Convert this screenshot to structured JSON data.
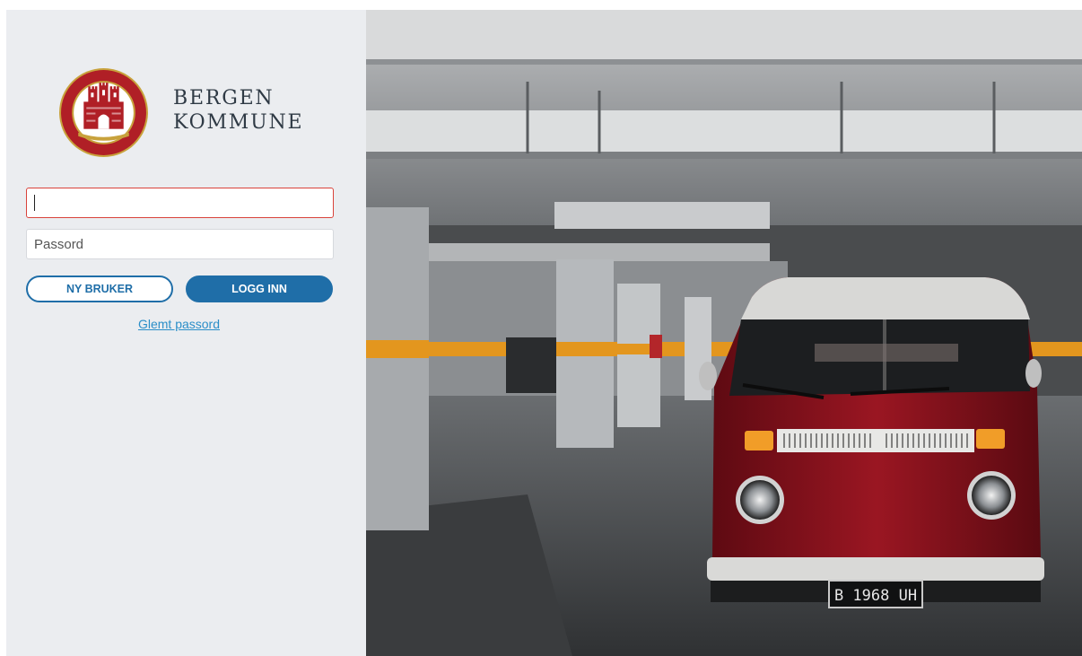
{
  "brand": {
    "line1": "BERGEN",
    "line2": "KOMMUNE"
  },
  "login": {
    "username_value": "",
    "username_placeholder": "",
    "password_placeholder": "Passord",
    "new_user_label": "NY BRUKER",
    "login_label": "LOGG INN",
    "forgot_label": "Glemt passord"
  },
  "photo": {
    "plate_text": "B 1968 UH"
  },
  "colors": {
    "accent": "#1f6ea8",
    "link": "#2b8ec8",
    "error_border": "#d9433b",
    "panel_bg": "#ebedf0"
  },
  "icons": {
    "logo": "bergen-coat-of-arms-seal"
  }
}
